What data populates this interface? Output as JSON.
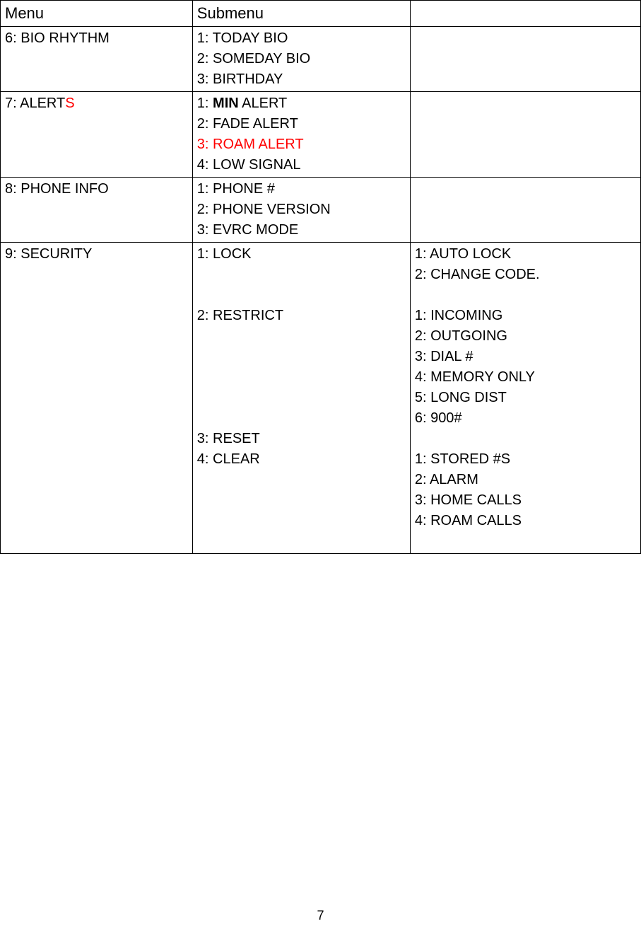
{
  "headers": {
    "menu": "Menu",
    "submenu": "Submenu",
    "detail": ""
  },
  "rows": {
    "bio_rhythm": {
      "menu": "6: BIO RHYTHM",
      "submenu": [
        "1: TODAY BIO",
        "2: SOMEDAY BIO",
        "3: BIRTHDAY"
      ]
    },
    "alerts": {
      "menu_prefix": "7: ALERT",
      "menu_suffix": "S",
      "submenu": {
        "l1_prefix": "1: ",
        "l1_bold": "MIN",
        "l1_suffix": " ALERT",
        "l2": "2: FADE ALERT",
        "l3": "3: ROAM ALERT",
        "l4": "4: LOW SIGNAL"
      }
    },
    "phone_info": {
      "menu": "8: PHONE INFO",
      "submenu": [
        "1: PHONE #",
        "2: PHONE VERSION",
        "3: EVRC MODE"
      ]
    },
    "security": {
      "menu": "9: SECURITY",
      "submenu": {
        "s1": "1: LOCK",
        "s2": "2: RESTRICT",
        "s3": "3: RESET",
        "s4": "4: CLEAR"
      },
      "detail_lock": [
        "1: AUTO LOCK",
        "2: CHANGE CODE."
      ],
      "detail_restrict": [
        "1: INCOMING",
        "2: OUTGOING",
        "3: DIAL #",
        "4: MEMORY ONLY",
        "5: LONG DIST",
        "6: 900#"
      ],
      "detail_clear": [
        "1: STORED #S",
        "2: ALARM",
        "3: HOME CALLS",
        "4: ROAM CALLS"
      ]
    }
  },
  "page_number": "7"
}
